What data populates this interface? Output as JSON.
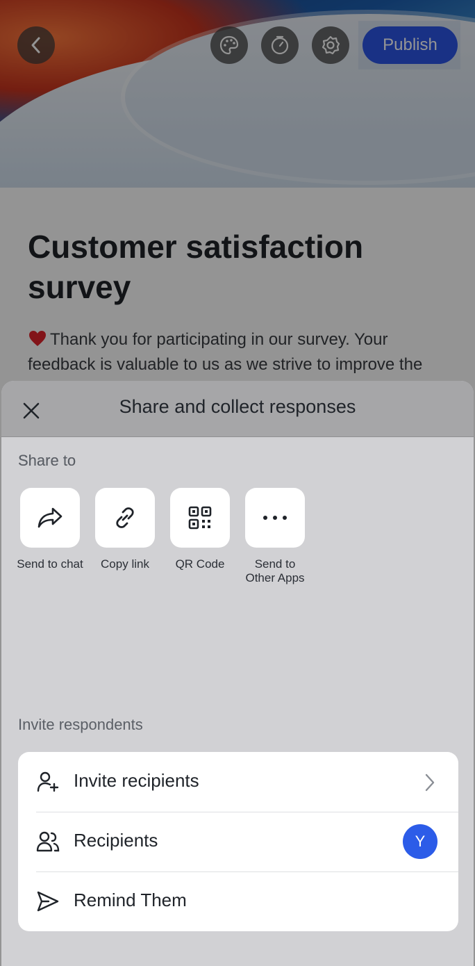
{
  "header": {
    "publish_label": "Publish",
    "icons": [
      "back-icon",
      "palette-icon",
      "timer-icon",
      "settings-icon"
    ]
  },
  "survey": {
    "title": "Customer satisfaction survey",
    "description": "Thank you for participating in our survey. Your feedback is valuable to us as we strive to improve the"
  },
  "sheet": {
    "title": "Share and collect responses",
    "share_to_label": "Share to",
    "share_items": [
      {
        "label": "Send to chat",
        "icon": "share-forward-icon"
      },
      {
        "label": "Copy link",
        "icon": "link-icon"
      },
      {
        "label": "QR Code",
        "icon": "qr-code-icon"
      },
      {
        "label": "Send to Other Apps",
        "icon": "more-icon"
      }
    ],
    "invite_label": "Invite respondents",
    "invite_rows": [
      {
        "label": "Invite recipients",
        "icon": "add-user-icon"
      },
      {
        "label": "Recipients",
        "icon": "users-icon",
        "avatar": "Y"
      },
      {
        "label": "Remind Them",
        "icon": "send-icon"
      }
    ]
  },
  "colors": {
    "accent": "#2c55e6",
    "avatar": "#2c5ce8"
  }
}
